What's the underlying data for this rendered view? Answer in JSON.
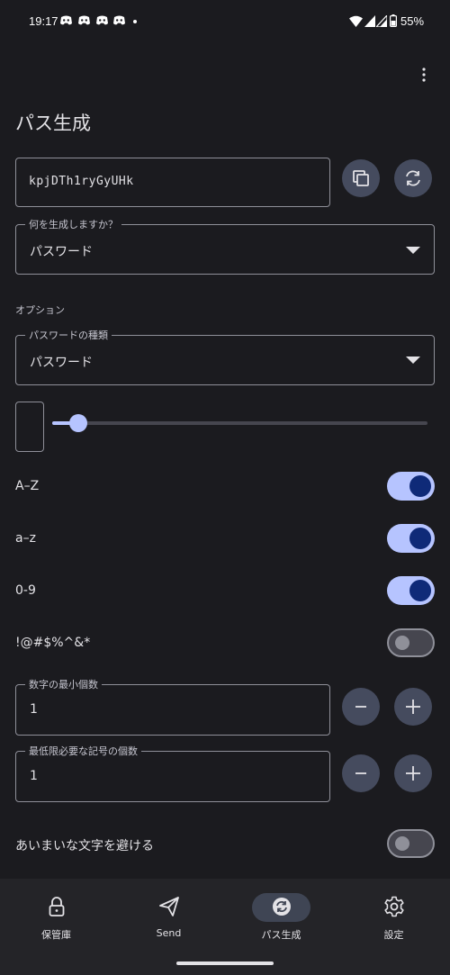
{
  "status_bar": {
    "time": "19:17",
    "battery": "55%"
  },
  "page": {
    "title": "パス生成"
  },
  "password": {
    "value": "kpjDTh1ryGyUHk"
  },
  "generate_type": {
    "legend": "何を生成しますか？",
    "value": "パスワード"
  },
  "options": {
    "section_label": "オプション"
  },
  "password_type": {
    "legend": "パスワードの種類",
    "value": "パスワード"
  },
  "length_slider": {
    "value_fraction": 0.07
  },
  "toggles": [
    {
      "label": "A–Z",
      "on": true
    },
    {
      "label": "a–z",
      "on": true
    },
    {
      "label": "0-9",
      "on": true
    },
    {
      "label": "!@#$%^&*",
      "on": false
    }
  ],
  "min_numbers": {
    "legend": "数字の最小個数",
    "value": "1"
  },
  "min_special": {
    "legend": "最低限必要な記号の個数",
    "value": "1"
  },
  "avoid_ambiguous": {
    "label": "あいまいな文字を避ける",
    "on": false
  },
  "nav": {
    "vault": "保管庫",
    "send": "Send",
    "generator": "パス生成",
    "settings": "設定"
  },
  "colors": {
    "accent": "#b6c4ff",
    "background": "#1b1b1f",
    "nav_bg": "#242428"
  }
}
